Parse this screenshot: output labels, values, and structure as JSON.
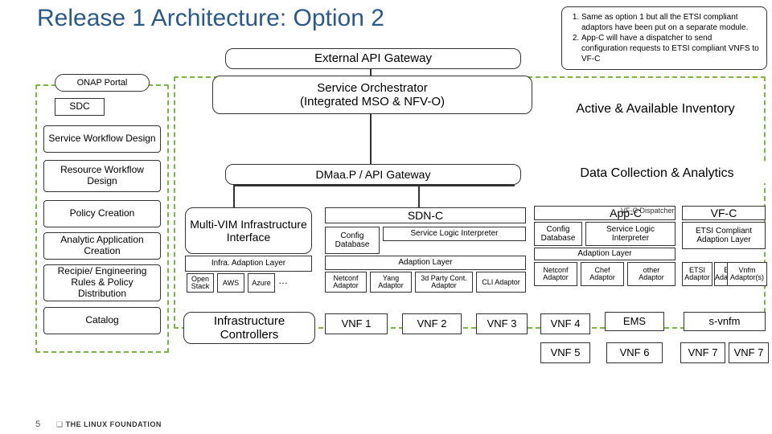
{
  "title": "Release 1 Architecture: Option 2",
  "notes": [
    "Same as option 1 but all the ETSI compliant adaptors have been put on a separate module.",
    "App-C will have a dispatcher to send configuration requests to ETSI compliant VNFS to VF-C"
  ],
  "left": {
    "onap": "ONAP Portal",
    "sdc": "SDC",
    "items": [
      "Service Workflow Design",
      "Resource Workflow Design",
      "Policy Creation",
      "Analytic Application Creation",
      "Recipie/ Engineering Rules & Policy Distribution",
      "Catalog"
    ]
  },
  "main": {
    "ext_gw": "External API Gateway",
    "so": "Service Orchestrator\n(Integrated MSO & NFV-O)",
    "aai": "Active & Available Inventory",
    "dmaap": "DMaa.P / API Gateway",
    "dca": "Data Collection & Analytics",
    "mvii": "Multi-VIM Infrastructure Interface",
    "infra_al": "Infra. Adaption Layer",
    "infra_boxes": [
      "Open Stack",
      "AWS",
      "Azure"
    ],
    "dots": "…",
    "sdnc": "SDN-C",
    "cfg": "Config Database",
    "sli": "Service Logic Interpreter",
    "adaption": "Adaption Layer",
    "sdnc_boxes": [
      "Netconf Adaptor",
      "Yang Adaptor",
      "3d Party Cont. Adaptor",
      "CLI Adaptor"
    ],
    "appc": "App-C",
    "vfc_disp": "VF-C Dispatcher",
    "appc_boxes": [
      "Netconf Adaptor",
      "Chef Adaptor",
      "other Adaptor"
    ],
    "vfc": "VF-C",
    "etsi": "ETSI Compliant Adaption Layer",
    "vfc_boxes": [
      "ETSI Adaptor",
      "EMS Adaptor(s)",
      "Vnfm Adaptor(s)"
    ],
    "ic": "Infrastructure Controllers"
  },
  "vnfs": {
    "v1": "VNF 1",
    "v2": "VNF 2",
    "v3": "VNF 3",
    "v4": "VNF 4",
    "ems": "EMS",
    "svnfm": "s-vnfm",
    "v5": "VNF 5",
    "v6": "VNF 6",
    "v7": "VNF 7",
    "v7b": "VNF 7"
  },
  "footer": "THE LINUX FOUNDATION",
  "page": "5"
}
